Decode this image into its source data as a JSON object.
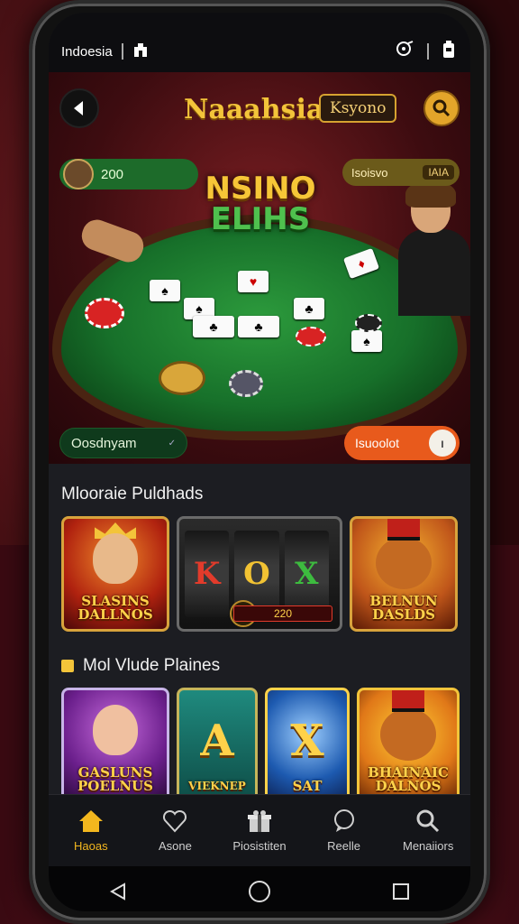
{
  "status_bar": {
    "carrier": "Indoesia"
  },
  "header": {
    "app_title": "Naaahsia",
    "tag": "Ksyono"
  },
  "balances": {
    "left_amount": "200",
    "right_label": "Isoisvo",
    "right_badge": "IAIA"
  },
  "hero": {
    "logo_line1": "NSINO",
    "logo_line2": "ELIHS",
    "lobby_label": "Oosdnyam",
    "action_label": "Isuoolot"
  },
  "section1": {
    "title": "Mlooraie Puldhads",
    "games": [
      {
        "title": "SLASINS DALLNOS"
      },
      {
        "reels": [
          "K",
          "O",
          "X"
        ],
        "jackpot": "220"
      },
      {
        "title": "BELNUN DASLDS"
      }
    ]
  },
  "section2": {
    "title": "Mol Vlude Plaines",
    "games": [
      {
        "title": "GASLUNS POELNUS"
      },
      {
        "letter": "A",
        "label": "VIEKNEP"
      },
      {
        "letter": "X",
        "label": "SAT"
      },
      {
        "title": "BHAINAIC DALNOS"
      }
    ]
  },
  "bottom_nav": [
    {
      "label": "Haoas",
      "icon": "home-icon",
      "active": true
    },
    {
      "label": "Asone",
      "icon": "heart-icon",
      "active": false
    },
    {
      "label": "Piosistiten",
      "icon": "gift-icon",
      "active": false
    },
    {
      "label": "Reelle",
      "icon": "chat-icon",
      "active": false
    },
    {
      "label": "Menaiiors",
      "icon": "search-icon",
      "active": false
    }
  ],
  "colors": {
    "accent": "#f3b71e",
    "felt": "#17702a",
    "action": "#e85a1c"
  }
}
